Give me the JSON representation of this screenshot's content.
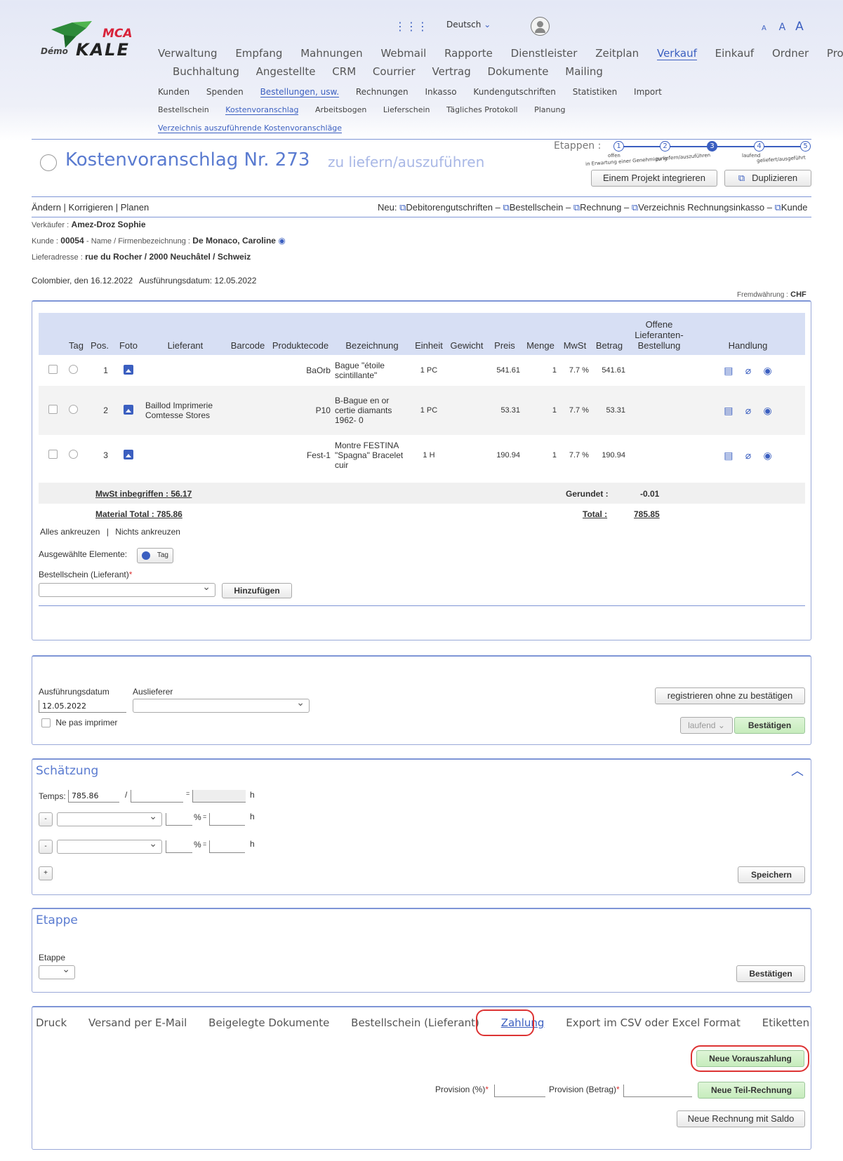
{
  "logo": {
    "brand_top": "MCA",
    "brand_main": "KALE",
    "brand_prefix": "Démo"
  },
  "header": {
    "language": "Deutsch",
    "font_sizes": [
      "A",
      "A",
      "A"
    ]
  },
  "nav": {
    "main": [
      "Verwaltung",
      "Empfang",
      "Mahnungen",
      "Webmail",
      "Rapporte",
      "Dienstleister",
      "Zeitplan",
      "Verkauf",
      "Einkauf",
      "Ordner",
      "Projekte"
    ],
    "main2": [
      "Buchhaltung",
      "Angestellte",
      "CRM",
      "Courrier",
      "Vertrag",
      "Dokumente",
      "Mailing"
    ],
    "sub1": [
      "Kunden",
      "Spenden",
      "Bestellungen, usw.",
      "Rechnungen",
      "Inkasso",
      "Kundengutschriften",
      "Statistiken",
      "Import"
    ],
    "sub2": [
      "Bestellschein",
      "Kostenvoranschlag",
      "Arbeitsbogen",
      "Lieferschein",
      "Tägliches Protokoll",
      "Planung"
    ],
    "sub3": "Verzeichnis auszuführende Kostenvoranschläge"
  },
  "doc": {
    "title": "Kostenvoranschlag Nr. 273",
    "status": "zu liefern/auszuführen",
    "etappen_label": "Etappen :",
    "steps": [
      "1",
      "2",
      "3",
      "4",
      "5"
    ],
    "step_labels": [
      "offen",
      "in Erwartung einer Genehmigung",
      "zu liefern/auszuführen",
      "laufend",
      "geliefert/ausgeführt"
    ],
    "btn_integrate": "Einem Projekt integrieren",
    "btn_duplicate": "Duplizieren"
  },
  "actions": {
    "left": "Ändern | Korrigieren | Planen",
    "new_label": "Neu:",
    "new_links": [
      "Debitorengutschriften",
      "Bestellschein",
      "Rechnung",
      "Verzeichnis Rechnungsinkasso",
      "Kunde"
    ]
  },
  "info": {
    "seller_label": "Verkäufer :",
    "seller": "Amez-Droz Sophie",
    "client_label": "Kunde :",
    "client_no": "00054",
    "name_label": "- Name / Firmenbezeichnung :",
    "client_name": "De Monaco, Caroline",
    "address_label": "Lieferadresse :",
    "address": "rue du Rocher / 2000 Neuchâtel / Schweiz",
    "place_date": "Colombier, den 16.12.2022",
    "exec_date": "Ausführungsdatum: 12.05.2022",
    "currency_label": "Fremdwährung :",
    "currency": "CHF"
  },
  "table": {
    "headers": [
      "Tag",
      "Pos.",
      "Foto",
      "Lieferant",
      "Barcode",
      "Produktecode",
      "Bezeichnung",
      "Einheit",
      "Gewicht",
      "Preis",
      "Menge",
      "MwSt",
      "Betrag",
      "Offene Lieferanten-Bestellung",
      "Handlung"
    ],
    "rows": [
      {
        "pos": "1",
        "supplier": "",
        "code": "BaOrb",
        "desc": "Bague \"étoile scintillante\"",
        "unit": "1 PC",
        "price": "541.61",
        "qty": "1",
        "vat": "7.7 %",
        "amount": "541.61"
      },
      {
        "pos": "2",
        "supplier": "Baillod Imprimerie Comtesse Stores",
        "code": "P10",
        "desc": "B-Bague en or certie diamants 1962- 0",
        "unit": "1 PC",
        "price": "53.31",
        "qty": "1",
        "vat": "7.7 %",
        "amount": "53.31"
      },
      {
        "pos": "3",
        "supplier": "",
        "code": "Fest-1",
        "desc": "Montre FESTINA \"Spagna\" Bracelet cuir",
        "unit": "1 H",
        "price": "190.94",
        "qty": "1",
        "vat": "7.7 %",
        "amount": "190.94"
      }
    ],
    "vat_incl": "MwSt inbegriffen : 56.17",
    "rounded_label": "Gerundet :",
    "rounded": "-0.01",
    "material_total": "Material Total : 785.86",
    "total_label": "Total :",
    "total": "785.85"
  },
  "selection": {
    "check_all": "Alles ankreuzen",
    "check_none": "Nichts ankreuzen",
    "selected_label": "Ausgewählte Elemente:",
    "tag_btn": "Tag",
    "order_label": "Bestellschein (Lieferant)",
    "add_btn": "Hinzufügen"
  },
  "exec": {
    "date_label": "Ausführungsdatum",
    "date_value": "12.05.2022",
    "deliverer_label": "Auslieferer",
    "no_print": "Ne pas imprimer",
    "register_btn": "registrieren ohne zu bestätigen",
    "status_select": "laufend",
    "confirm_btn": "Bestätigen"
  },
  "estimate": {
    "title": "Schätzung",
    "temps_label": "Temps:",
    "temps_value": "785.86",
    "h": "h",
    "pct": "%",
    "eq": "=",
    "minus": "-",
    "plus": "+",
    "save_btn": "Speichern"
  },
  "etappe": {
    "title": "Etappe",
    "label": "Etappe",
    "confirm_btn": "Bestätigen"
  },
  "bottom": {
    "tabs": [
      "Druck",
      "Versand per E-Mail",
      "Beigelegte Dokumente",
      "Bestellschein (Lieferant)",
      "Zahlung",
      "Export im CSV oder Excel Format",
      "Etiketten"
    ],
    "prepay_btn": "Neue Vorauszahlung",
    "prov_pct_label": "Provision (%)",
    "prov_amt_label": "Provision (Betrag)",
    "partial_btn": "Neue Teil-Rechnung",
    "balance_btn": "Neue Rechnung mit Saldo"
  },
  "colors": {
    "accent": "#3b5fc0",
    "header_bg": "#d7dff4",
    "green_btn": "#c6ecbc",
    "highlight": "#dd3333"
  }
}
